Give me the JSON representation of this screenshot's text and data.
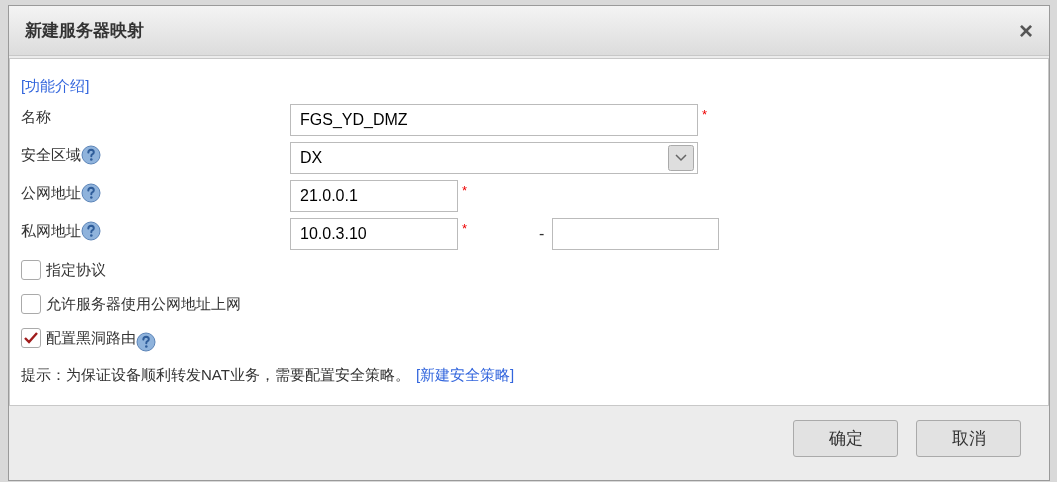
{
  "dialog": {
    "title": "新建服务器映射",
    "close": "×"
  },
  "help_link": "[功能介绍]",
  "fields": [
    {
      "kind": "text",
      "label": "名称",
      "help": false,
      "value": "FGS_YD_DMZ",
      "required_mark": "*"
    },
    {
      "kind": "select",
      "label": "安全区域",
      "help": true,
      "value": "DX"
    },
    {
      "kind": "address",
      "label": "公网地址",
      "help": true,
      "value": "21.0.0.1",
      "required_mark": "*"
    },
    {
      "kind": "range",
      "label": "私网地址",
      "help": true,
      "value": "10.0.3.10",
      "required_mark": "*",
      "separator": "-"
    }
  ],
  "checkboxes": [
    {
      "label": "指定协议",
      "checked": false,
      "help": false
    },
    {
      "label": "允许服务器使用公网地址上网",
      "checked": false,
      "help": false
    },
    {
      "label": "配置黑洞路由",
      "checked": true,
      "help": true
    }
  ],
  "hint": {
    "text": "提示：为保证设备顺利转发NAT业务，需要配置安全策略。",
    "link": "[新建安全策略]"
  },
  "buttons": [
    "确定",
    "取消"
  ]
}
